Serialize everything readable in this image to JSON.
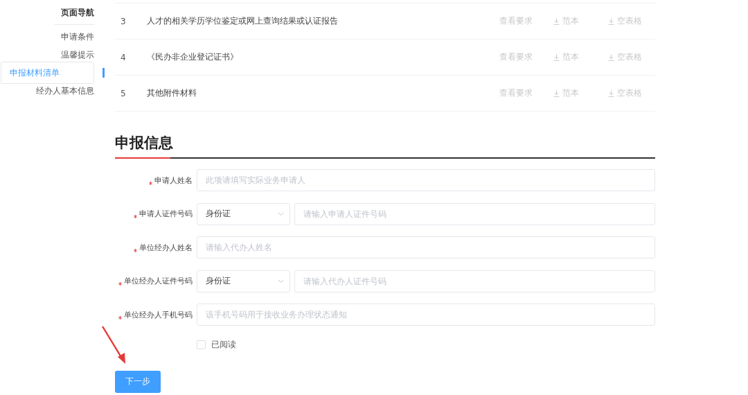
{
  "nav": {
    "title": "页面导航",
    "items": [
      {
        "label": "申请条件",
        "selected": false
      },
      {
        "label": "温馨提示",
        "selected": false
      },
      {
        "label": "申报材料清单",
        "selected": true
      },
      {
        "label": "经办人基本信息",
        "selected": false
      }
    ]
  },
  "materials": [
    {
      "index": "3",
      "name": "人才的相关学历学位鉴定或网上查询结果或认证报告",
      "actions": [
        {
          "kind": "link",
          "label": "查看要求"
        },
        {
          "kind": "download",
          "label": "范本"
        },
        {
          "kind": "download",
          "label": "空表格"
        }
      ]
    },
    {
      "index": "4",
      "name": "《民办非企业登记证书》",
      "actions": [
        {
          "kind": "link",
          "label": "查看要求"
        },
        {
          "kind": "download",
          "label": "范本"
        },
        {
          "kind": "download",
          "label": "空表格"
        }
      ]
    },
    {
      "index": "5",
      "name": "其他附件材料",
      "actions": [
        {
          "kind": "link",
          "label": "查看要求"
        },
        {
          "kind": "download",
          "label": "范本"
        },
        {
          "kind": "download",
          "label": "空表格"
        }
      ]
    }
  ],
  "section_title": "申报信息",
  "fields": [
    {
      "kind": "text",
      "label": "申请人姓名",
      "required": true,
      "placeholder": "此项请填写实际业务申请人"
    },
    {
      "kind": "id",
      "label": "申请人证件号码",
      "required": true,
      "select_value": "身份证",
      "placeholder": "请输入申请人证件号码"
    },
    {
      "kind": "text",
      "label": "单位经办人姓名",
      "required": true,
      "placeholder": "请输入代办人姓名"
    },
    {
      "kind": "id",
      "label": "单位经办人证件号码",
      "required": true,
      "select_value": "身份证",
      "placeholder": "请输入代办人证件号码"
    },
    {
      "kind": "text",
      "label": "单位经办人手机号码",
      "required": true,
      "placeholder": "该手机号码用于接收业务办理状态通知"
    }
  ],
  "agreement": {
    "label": "已阅读",
    "checked": false
  },
  "next_button": "下一步"
}
